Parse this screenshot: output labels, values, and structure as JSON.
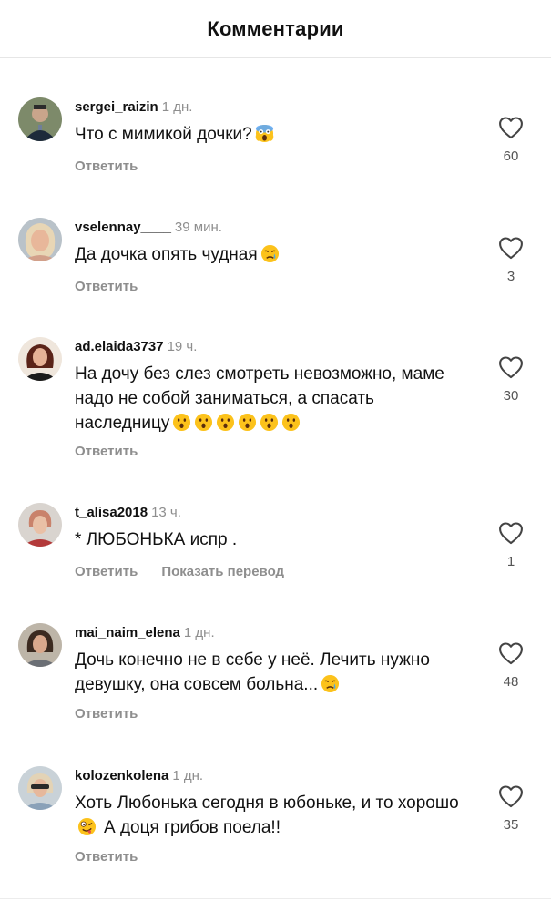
{
  "header": {
    "title": "Комментарии"
  },
  "actions": {
    "reply_label": "Ответить",
    "translate_label": "Показать перевод"
  },
  "colors": {
    "secondary_text": "#8e8e8e",
    "primary_text": "#111111",
    "divider": "#e6e6e6"
  },
  "comments": [
    {
      "username": "sergei_raizin",
      "time": "1 дн.",
      "text": "Что с мимикой дочки?",
      "emoji": "screaming-face-icon",
      "likes": "60"
    },
    {
      "username": "vselennay____",
      "time": "39 мин.",
      "text": "Да дочка опять чудная",
      "emoji": "crying-face-icon",
      "likes": "3"
    },
    {
      "username": "ad.elaida3737",
      "time": "19 ч.",
      "text": "На дочу без слез смотреть невозможно, маме надо не собой заниматься, а спасать наследницу",
      "emoji": "astonished-face-icon",
      "likes": "30"
    },
    {
      "username": "t_alisa2018",
      "time": "13 ч.",
      "text": "* ЛЮБОНЬКА испр .",
      "likes": "1"
    },
    {
      "username": "mai_naim_elena",
      "time": "1 дн.",
      "text": "Дочь конечно не в себе у неё. Лечить нужно девушку, она совсем больна...",
      "emoji": "crying-face-icon",
      "likes": "48"
    },
    {
      "username": "kolozenkolena",
      "time": "1 дн.",
      "text_part1": "Хоть Любонька сегодня в юбоньке, и то хорошо",
      "text_part2": "А доця грибов поела!!",
      "emoji": "zany-face-icon",
      "likes": "35"
    }
  ]
}
